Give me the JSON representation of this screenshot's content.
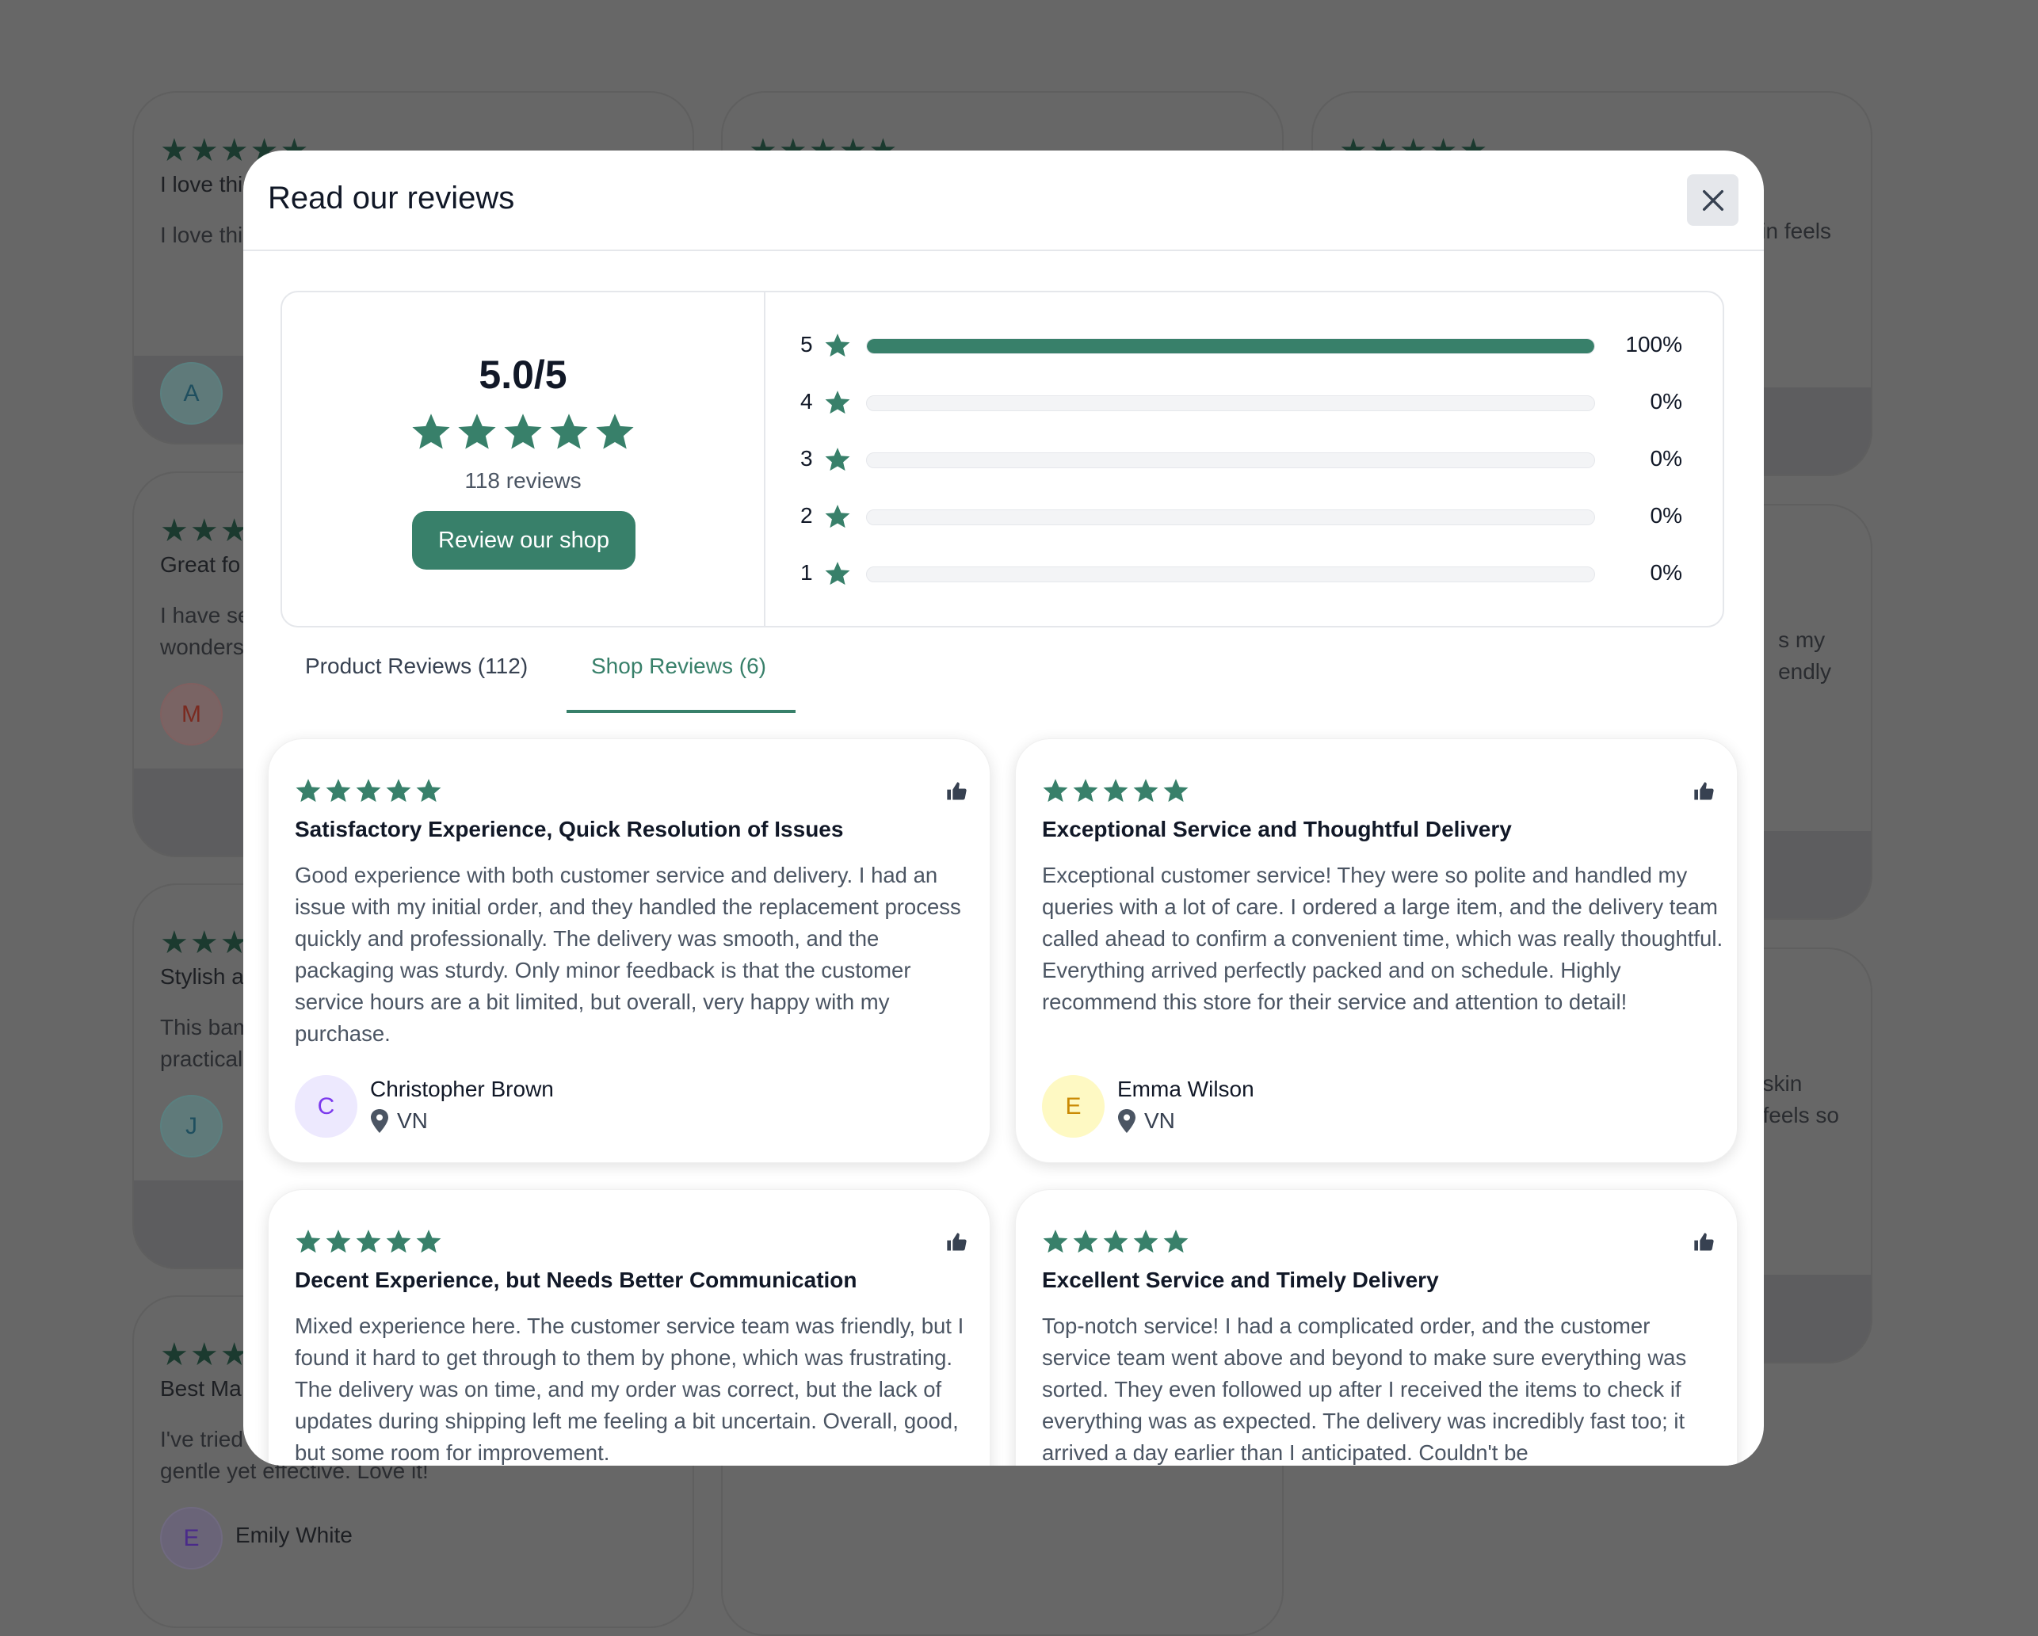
{
  "background": {
    "cards": [
      {
        "title": "I love thi",
        "text": "I love thi",
        "avatar": "A"
      },
      {
        "title": "Great fo",
        "text": "I have se\nwonders",
        "avatar": "M"
      },
      {
        "title": "Stylish a",
        "text": "This bam\npractical",
        "avatar": "J"
      },
      {
        "title": "Best Ma",
        "text": "I've tried\ngentle yet effective. Love it!",
        "avatar": "E",
        "name": "Emily White"
      }
    ],
    "right_fragments": [
      "in feels",
      "s my\nendly",
      "skin\nfeels so"
    ]
  },
  "modal": {
    "title": "Read our reviews",
    "close_icon": "close-icon",
    "summary": {
      "score": "5.0/5",
      "rating": 5,
      "count": "118 reviews",
      "button": "Review our shop",
      "distribution": [
        {
          "stars": "5",
          "percent": 100,
          "label": "100%"
        },
        {
          "stars": "4",
          "percent": 0,
          "label": "0%"
        },
        {
          "stars": "3",
          "percent": 0,
          "label": "0%"
        },
        {
          "stars": "2",
          "percent": 0,
          "label": "0%"
        },
        {
          "stars": "1",
          "percent": 0,
          "label": "0%"
        }
      ]
    },
    "tabs": [
      {
        "label": "Product Reviews (112)",
        "active": false
      },
      {
        "label": "Shop Reviews (6)",
        "active": true
      }
    ],
    "reviews": [
      {
        "rating": 5,
        "title": "Satisfactory Experience, Quick Resolution of Issues",
        "body": "Good experience with both customer service and delivery. I had an issue with my initial order, and they handled the replacement process quickly and professionally. The delivery was smooth, and the packaging was sturdy. Only minor feedback is that the customer service hours are a bit limited, but overall, very happy with my purchase.",
        "avatar": "C",
        "name": "Christopher Brown",
        "location": "VN",
        "avatar_bg": "#ede9fe",
        "avatar_fg": "#7c3aed"
      },
      {
        "rating": 5,
        "title": "Exceptional Service and Thoughtful Delivery",
        "body": "Exceptional customer service! They were so polite and handled my queries with a lot of care. I ordered a large item, and the delivery team called ahead to confirm a convenient time, which was really thoughtful. Everything arrived perfectly packed and on schedule. Highly recommend this store for their service and attention to detail!",
        "avatar": "E",
        "name": "Emma Wilson",
        "location": "VN",
        "avatar_bg": "#fef9c3",
        "avatar_fg": "#ca8a04"
      },
      {
        "rating": 5,
        "title": "Decent Experience, but Needs Better Communication",
        "body": "Mixed experience here. The customer service team was friendly, but I found it hard to get through to them by phone, which was frustrating. The delivery was on time, and my order was correct, but the lack of updates during shipping left me feeling a bit uncertain. Overall, good, but some room for improvement."
      },
      {
        "rating": 5,
        "title": "Excellent Service and Timely Delivery",
        "body": "Top-notch service! I had a complicated order, and the customer service team went above and beyond to make sure everything was sorted. They even followed up after I received the items to check if everything was as expected. The delivery was incredibly fast too; it arrived a day earlier than I anticipated. Couldn't be"
      }
    ],
    "accent_color": "#38806a"
  }
}
